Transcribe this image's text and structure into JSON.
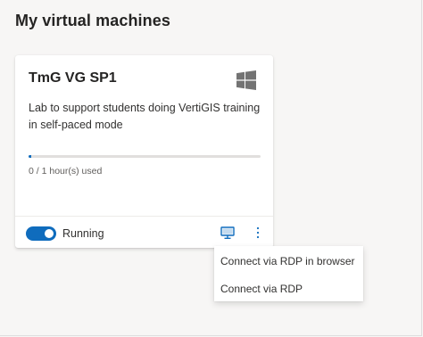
{
  "page": {
    "title": "My virtual machines"
  },
  "vm_card": {
    "name": "TmG VG SP1",
    "os_icon": "windows-icon",
    "description": "Lab to support students doing VertiGIS training in self-paced mode",
    "usage_text": "0 / 1 hour(s) used",
    "usage_progress_fraction": 0.01,
    "status": "Running",
    "status_toggle_on": true,
    "connect_icon": "monitor-icon",
    "more_icon": "more-vertical-icon"
  },
  "connect_menu": {
    "items": [
      {
        "label": "Connect via RDP in browser"
      },
      {
        "label": "Connect via RDP"
      }
    ]
  },
  "colors": {
    "accent": "#0f6cbd",
    "windows_logo": "#737373",
    "background": "#f7f6f5"
  }
}
